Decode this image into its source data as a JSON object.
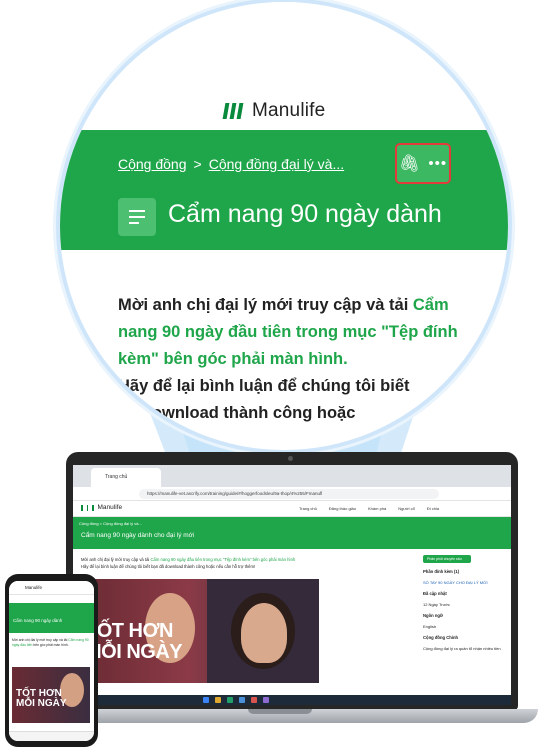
{
  "brand": {
    "name": "Manulife",
    "color": "#1fa64a"
  },
  "zoom": {
    "breadcrumb": [
      "Cộng đồng",
      "Cộng đồng đại lý và..."
    ],
    "breadcrumb_sep": ">",
    "actions": {
      "attach_icon": "paperclip-icon",
      "more_icon": "more-dots-icon",
      "attach_glyph": "🖇",
      "more_glyph": "•••"
    },
    "title": "Cẩm nang 90 ngày dành",
    "body_parts": [
      {
        "text": "Mời anh chị đại lý mới truy cập và tải ",
        "green": false
      },
      {
        "text": "Cẩm nang 90 ngày đầu tiên trong mục \"Tệp đính kèm\"",
        "green": true
      },
      {
        "text": " bên góc phải màn hình.",
        "green": false
      }
    ],
    "body_line2": "Hãy để lại bình luận để chúng tôi biết",
    "body_line3": "đã download thành công hoặc"
  },
  "laptop": {
    "tab_label": "Trang chủ",
    "url": "https://manulife-vet.ascrify.com/training/guide/#/hoggerfoodsleu/9a-thop/4%255/Fmanufl",
    "app_name": "Manulife",
    "menu": [
      "Trang chủ",
      "Đăng thảo giảo",
      "Khám phá",
      "Người cổ",
      "Đi chia"
    ],
    "breadcrumb": "Cộng đồng > Cộng đồng đại lý và...",
    "title": "Cẩm nang 90 ngày dành cho đại lý mới",
    "text_plain": "Mời anh chị đại lý mới truy cập và tải ",
    "text_green": "Cẩm nang 90 ngày đầu tiên trong mục \"Tệp đính kèm\" bên góc phải màn hình",
    "text_line2": "Hãy để lại bình luận để chúng tôi biết bạn đã download thành công hoặc nếu cần hỗ trợ thêm!",
    "hero_text": [
      "TỐT HƠN",
      "MỖI NGÀY"
    ],
    "side": {
      "button": "Phân phối chuyên sâu",
      "attach": "Phần đính kèm (1)",
      "file": "SỐ TAY 90 NGÀY CHO ĐẠI LÝ MỚI",
      "last_update": "Đã cập nhật",
      "date": "12 Ngày Trước",
      "lang_label": "Ngôn ngữ",
      "lang": "English",
      "group": "Cộng đồng Chính",
      "group_text": "Cộng đồng đại lý ra quân tổ nhận nhiều tiền"
    }
  },
  "phone": {
    "app_name": "Manulife",
    "title": "Cẩm nang 90 ngày dành",
    "text_plain": "Mời anh chị đại lý mới truy cập và tải ",
    "text_green": "Cẩm nang 90 ngày đầu tiên",
    "text_rest": " bên góc phải màn hình.",
    "hero_text": [
      "TỐT HƠN",
      "MỖI NGÀY"
    ]
  }
}
